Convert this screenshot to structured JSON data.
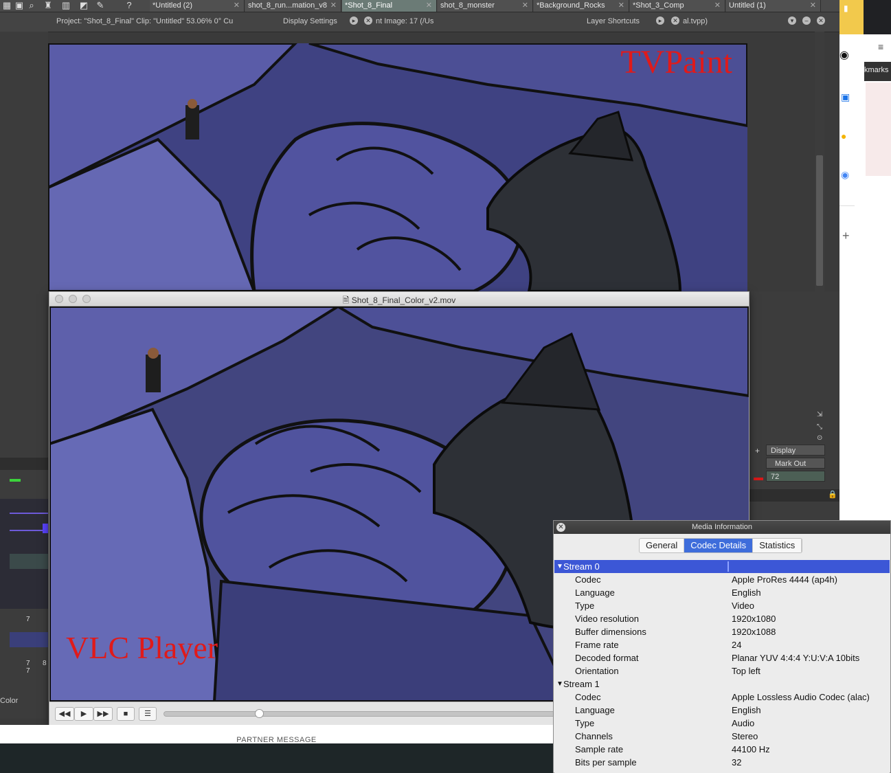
{
  "tvpaint": {
    "tabs": [
      {
        "label": "*Untitled (2)",
        "active": false
      },
      {
        "label": "shot_8_run...mation_v8",
        "active": false
      },
      {
        "label": "*Shot_8_Final",
        "active": true
      },
      {
        "label": "shot_8_monster",
        "active": false
      },
      {
        "label": "*Background_Rocks",
        "active": false
      },
      {
        "label": "*Shot_3_Comp",
        "active": false
      },
      {
        "label": "Untitled (1)",
        "active": false
      }
    ],
    "project_info": "Project:  \"Shot_8_Final\"  Clip: \"Untitled\"  53.06%  0°  Cu",
    "display_settings_label": "Display Settings",
    "current_image": "nt Image: 17 (/Us",
    "layer_shortcuts_label": "Layer Shortcuts",
    "file_suffix": "al.tvpp)",
    "overlay_label": "TVPaint",
    "display_button": "Display",
    "mark_out_button": "Mark Out",
    "mark_out_value": "72",
    "frame_numbers": [
      "7",
      "7",
      "8",
      "7"
    ],
    "color_label": "Color"
  },
  "vlc": {
    "window_title": "Shot_8_Final_Color_v2.mov",
    "overlay_label": "VLC Player",
    "seek_position": 0.23,
    "buttons": {
      "rewind": "◀◀",
      "play": "▶",
      "forward": "▶▶",
      "stop": "■",
      "playlist": "☰"
    }
  },
  "media_info": {
    "title": "Media Information",
    "tabs": [
      {
        "label": "General",
        "selected": false
      },
      {
        "label": "Codec Details",
        "selected": true
      },
      {
        "label": "Statistics",
        "selected": false
      }
    ],
    "streams": [
      {
        "name": "Stream 0",
        "rows": [
          {
            "key": "Codec",
            "value": "Apple ProRes 4444 (ap4h)"
          },
          {
            "key": "Language",
            "value": "English"
          },
          {
            "key": "Type",
            "value": "Video"
          },
          {
            "key": "Video resolution",
            "value": "1920x1080"
          },
          {
            "key": "Buffer dimensions",
            "value": "1920x1088"
          },
          {
            "key": "Frame rate",
            "value": "24"
          },
          {
            "key": "Decoded format",
            "value": "Planar YUV 4:4:4 Y:U:V:A 10bits"
          },
          {
            "key": "Orientation",
            "value": "Top left"
          }
        ]
      },
      {
        "name": "Stream 1",
        "rows": [
          {
            "key": "Codec",
            "value": "Apple Lossless Audio Codec (alac)"
          },
          {
            "key": "Language",
            "value": "English"
          },
          {
            "key": "Type",
            "value": "Audio"
          },
          {
            "key": "Channels",
            "value": "Stereo"
          },
          {
            "key": "Sample rate",
            "value": "44100 Hz"
          },
          {
            "key": "Bits per sample",
            "value": "32"
          }
        ]
      }
    ]
  },
  "browser": {
    "bookmarks_fragment": "kmarks"
  },
  "page": {
    "partner_message": "PARTNER MESSAGE"
  },
  "colors": {
    "accent_red": "#e01a1a",
    "selection_blue": "#3c57d6",
    "tab_blue": "#3e6ddb",
    "rock_purple": "#4b4f9a"
  }
}
